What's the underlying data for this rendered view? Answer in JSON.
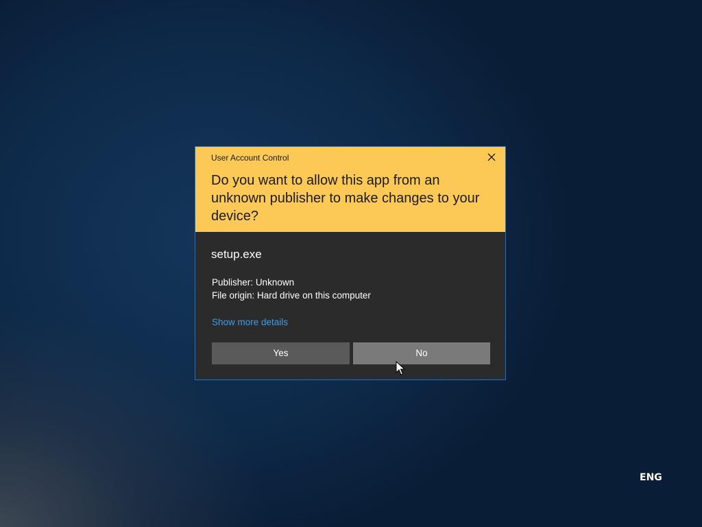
{
  "dialog": {
    "title": "User Account Control",
    "question": "Do you want to allow this app from an unknown publisher to make changes to your device?",
    "close_icon": "close-icon",
    "app_name": "setup.exe",
    "publisher_label": "Publisher:",
    "publisher_value": "Unknown",
    "origin_label": "File origin:",
    "origin_value": "Hard drive on this computer",
    "more_details_label": "Show more details",
    "yes_label": "Yes",
    "no_label": "No"
  },
  "tray": {
    "language": "ENG"
  },
  "colors": {
    "header_bg": "#fcc957",
    "body_bg": "#2b2b2b",
    "border": "#1a73c8",
    "link": "#3f9ce8",
    "yes_button": "#5a5a5a",
    "no_button_hover": "#7a7a7a"
  }
}
